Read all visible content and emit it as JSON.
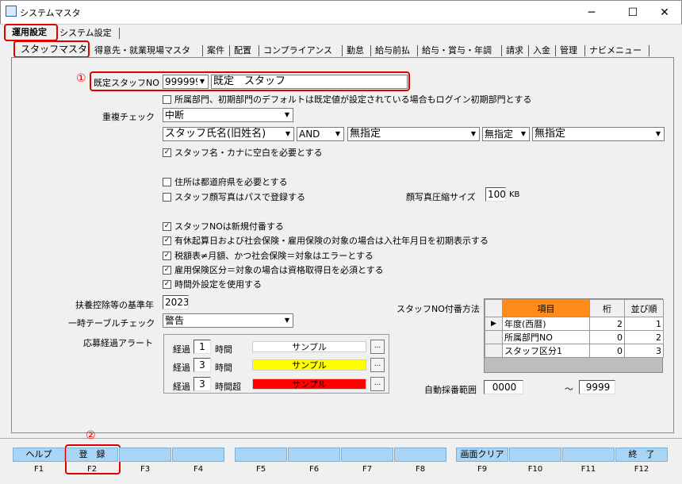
{
  "window": {
    "title": "システムマスタ",
    "minimize": "─",
    "maximize": "☐",
    "close": "✕"
  },
  "top_tabs": [
    "運用設定",
    "システム設定"
  ],
  "sub_tabs": [
    "スタッフマスタ",
    "得意先・就業現場マスタ",
    "案件",
    "配置",
    "コンプライアンス",
    "勤怠",
    "給与前払",
    "給与・賞与・年調",
    "請求",
    "入金",
    "管理",
    "ナビメニュー"
  ],
  "annotations": {
    "one": "①",
    "two": "②"
  },
  "default_staff": {
    "label": "既定スタッフNO",
    "code": "999999",
    "name": "既定　スタッフ"
  },
  "checks": {
    "dept": {
      "label": "所属部門、初期部門のデフォルトは既定値が設定されている場合もログイン初期部門とする",
      "checked": false
    },
    "space": {
      "label": "スタッフ名・カナに空白を必要とする",
      "checked": true
    },
    "address": {
      "label": "住所は都道府県を必要とする",
      "checked": false
    },
    "photo": {
      "label": "スタッフ顔写真はパスで登録する",
      "checked": false
    },
    "newno": {
      "label": "スタッフNOは新規付番する",
      "checked": true
    },
    "leave": {
      "label": "有休起算日および社会保険・雇用保険の対象の場合は入社年月日を初期表示する",
      "checked": true
    },
    "tax": {
      "label": "税額表≠月額、かつ社会保険＝対象はエラーとする",
      "checked": true
    },
    "employ": {
      "label": "雇用保険区分＝対象の場合は資格取得日を必須とする",
      "checked": true
    },
    "overtime": {
      "label": "時間外設定を使用する",
      "checked": true
    }
  },
  "dup_check": {
    "label": "重複チェック",
    "value": "中断",
    "field1": "スタッフ氏名(旧姓名)",
    "op": "AND",
    "field2": "無指定",
    "field3": "無指定",
    "field4": "無指定"
  },
  "photo_size": {
    "label": "顔写真圧縮サイズ",
    "value": "100",
    "unit": "KB"
  },
  "base_year": {
    "label": "扶養控除等の基準年",
    "value": "2023"
  },
  "temp_check": {
    "label": "一時テーブルチェック",
    "value": "警告"
  },
  "alert": {
    "label": "応募経過アラート",
    "rows": [
      {
        "prefix": "経過",
        "value": "1",
        "unit": "時間",
        "sample": "サンプル",
        "color": "#ffffff",
        "text_color": "#000000"
      },
      {
        "prefix": "経過",
        "value": "3",
        "unit": "時間",
        "sample": "サンプル",
        "color": "#ffff00",
        "text_color": "#000000"
      },
      {
        "prefix": "経過",
        "value": "3",
        "unit": "時間超",
        "sample": "サンプル",
        "color": "#ff0000",
        "text_color": "#000000"
      }
    ],
    "btn": "..."
  },
  "numbering": {
    "label": "スタッフNO付番方法",
    "headers": [
      "項目",
      "桁",
      "並び順"
    ],
    "rows": [
      {
        "item": "年度(西暦)",
        "digits": "2",
        "order": "1"
      },
      {
        "item": "所属部門NO",
        "digits": "0",
        "order": "2"
      },
      {
        "item": "スタッフ区分1",
        "digits": "0",
        "order": "3"
      }
    ],
    "header_color": "#ff8c1a"
  },
  "auto_range": {
    "label": "自動採番範囲",
    "from": "0000",
    "sep": "～",
    "to": "9999"
  },
  "fkeys": [
    {
      "label": "ヘルプ",
      "key": "F1"
    },
    {
      "label": "登　録",
      "key": "F2"
    },
    {
      "label": "",
      "key": "F3"
    },
    {
      "label": "",
      "key": "F4"
    },
    {
      "label": "",
      "key": "F5"
    },
    {
      "label": "",
      "key": "F6"
    },
    {
      "label": "",
      "key": "F7"
    },
    {
      "label": "",
      "key": "F8"
    },
    {
      "label": "画面クリア",
      "key": "F9"
    },
    {
      "label": "",
      "key": "F10"
    },
    {
      "label": "",
      "key": "F11"
    },
    {
      "label": "終　了",
      "key": "F12"
    }
  ]
}
